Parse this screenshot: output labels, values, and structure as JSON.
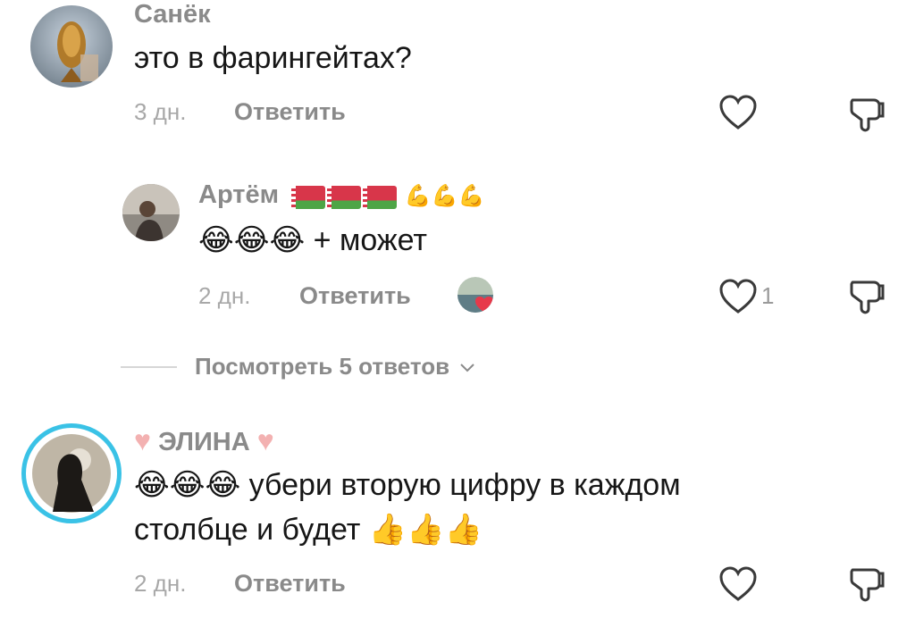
{
  "comments": [
    {
      "author": "Санёк",
      "text": "это в фарингейтах?",
      "time": "3 дн.",
      "reply_label": "Ответить",
      "avatar_icon": "fish-avatar"
    },
    {
      "author": "Артём",
      "author_decor": "🇧🇾🇧🇾🇧🇾💪💪💪",
      "text_suffix": "+ может",
      "time": "2 дн.",
      "reply_label": "Ответить",
      "like_count": "1",
      "avatar_icon": "person-avatar",
      "liked_by_author_icon": "creator-like-icon"
    },
    {
      "author": "ЭЛИНА",
      "line1": "убери вторую цифру в каждом",
      "line2": "столбце и будет",
      "time": "2 дн.",
      "reply_label": "Ответить",
      "avatar_icon": "person-avatar",
      "accent_color": "#3ac2e6"
    }
  ],
  "view_replies": {
    "label": "Посмотреть 5 ответов",
    "chevron": "chevron-down-icon"
  },
  "colors": {
    "text": "#161616",
    "muted": "#8a8a8a",
    "heart_pink": "#f3b1b1",
    "like_heart": "#e7394a"
  }
}
